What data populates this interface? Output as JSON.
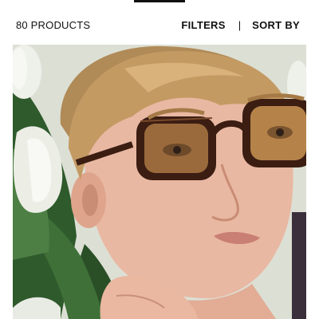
{
  "header": {
    "product_count": "80 PRODUCTS",
    "filters_label": "FILTERS",
    "separator": "|",
    "sort_label": "SORT BY"
  },
  "product_grid": {
    "items": [
      {
        "image": "model-wearing-tortoiseshell-sunglasses"
      }
    ]
  },
  "colors": {
    "text": "#111111",
    "background": "#ffffff",
    "lens": "#9a6a3c",
    "frame": "#3b1d12"
  }
}
